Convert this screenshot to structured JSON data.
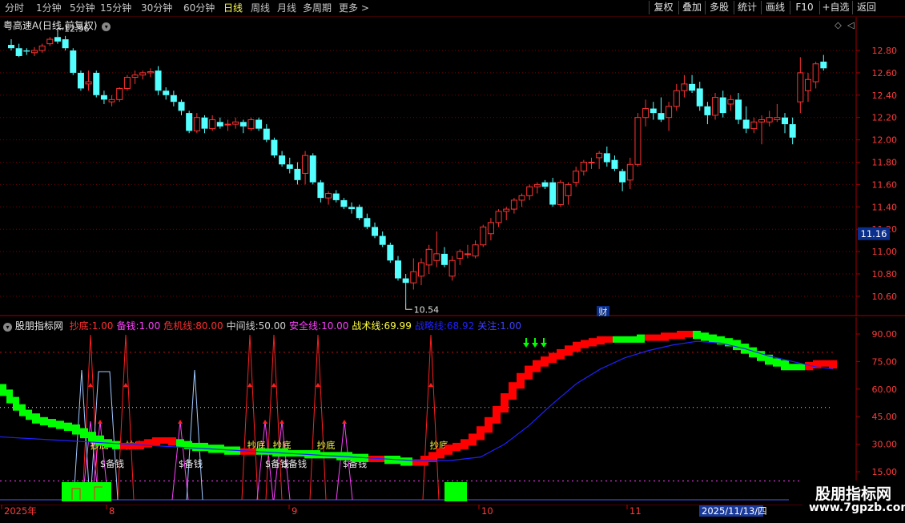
{
  "topbar": {
    "periods": [
      "分时",
      "1分钟",
      "5分钟",
      "15分钟",
      "30分钟",
      "60分钟",
      "日线",
      "周线",
      "月线",
      "多周期",
      "更多 >"
    ],
    "active_period": "日线",
    "buttons": [
      "复权",
      "叠加",
      "多股",
      "统计",
      "画线",
      "F10",
      "+自选",
      "返回"
    ]
  },
  "main": {
    "stock_name": "粤高速A",
    "mode": "(日线,前复权)",
    "high_mark": "12.96",
    "low_mark": "10.54",
    "price_badge": "11.16",
    "cai_badge": "财",
    "y_ticks": [
      "12.80",
      "12.60",
      "12.40",
      "12.20",
      "12.00",
      "11.80",
      "11.60",
      "11.40",
      "11.20",
      "11.00",
      "10.80",
      "10.60"
    ]
  },
  "indicator": {
    "name": "股朋指标网",
    "params": [
      {
        "label": "抄底:",
        "value": "1.00",
        "color": "#ff3030"
      },
      {
        "label": "备钱:",
        "value": "1.00",
        "color": "#ff40ff"
      },
      {
        "label": "危机线:",
        "value": "80.00",
        "color": "#ff3030"
      },
      {
        "label": "中间线:",
        "value": "50.00",
        "color": "#d0d0d0"
      },
      {
        "label": "安全线:",
        "value": "10.00",
        "color": "#ff40ff"
      },
      {
        "label": "战术线:",
        "value": "69.99",
        "color": "#ffff40"
      },
      {
        "label": "战略线:",
        "value": "68.92",
        "color": "#2020ff"
      },
      {
        "label": "关注:",
        "value": "1.00",
        "color": "#4040ff"
      }
    ],
    "y_ticks": [
      "90.00",
      "75.00",
      "60.00",
      "45.00",
      "30.00",
      "15.00"
    ],
    "text_chaodi": "抄底",
    "text_beiqian": "$备钱"
  },
  "xaxis": {
    "labels": [
      "2025年",
      "8",
      "9",
      "10",
      "11"
    ],
    "cursor_date": "2025/11/13/四"
  },
  "watermark": {
    "title": "股朋指标网",
    "url": "www.7gpzb.com"
  },
  "colors": {
    "up": "#ff3232",
    "down": "#54ffff",
    "bg": "#000000",
    "grid": "#a00000",
    "tactical_up": "#ff0000",
    "tactical_down": "#00ff00",
    "strategic": "#2020ff"
  }
}
